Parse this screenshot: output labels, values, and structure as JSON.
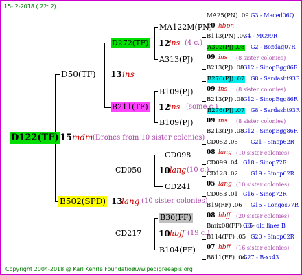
{
  "header": {
    "date": "15-  2-2018 ( 22:  2)"
  },
  "footer": {
    "copyright": "Copyright 2004-2018 @ Karl Kehrle Foundation.",
    "site": "www.pedigreeapis.org"
  },
  "colors": {
    "frame": "#cc00cc",
    "green_box": "#00dd00",
    "yellow_box": "#ffff00",
    "magenta_box": "#ff44ff",
    "cyan_box": "#00eeee",
    "gray_box": "#c0c0c0",
    "lines": "#000000",
    "footer_text": "#007700",
    "id_text": "#0000cc",
    "note_text": "#aa44aa",
    "race_text": "#cc0000"
  },
  "root": {
    "id": "D122(TF)",
    "gen": "15",
    "race": "mdm",
    "note": "(Drones from 10 sister colonies)"
  },
  "father": {
    "id": "D50(TF)",
    "gen": "13",
    "race": "ins"
  },
  "mother": {
    "id": "B502(SPD)",
    "gen": "13",
    "race": "lang",
    "note": "(10 sister colonies)"
  },
  "ff": {
    "id": "D272(TF)",
    "gen": "12",
    "race": "ins",
    "note": "(4 c.)"
  },
  "fm": {
    "id": "B211(TF)",
    "gen": "12",
    "race": "ins",
    "note": "(some c.)"
  },
  "mf": {
    "id": "CD050",
    "gen": "10",
    "race": "lang",
    "note": "(10 c.)"
  },
  "mm": {
    "id": "CD217",
    "gen": "10",
    "race": "hbff",
    "note": "(19 c.)"
  },
  "g4": [
    {
      "id": "MA122M(PN)"
    },
    {
      "id": "A313(PJ)"
    },
    {
      "id": "B109(PJ)"
    },
    {
      "id": "B109(PJ)"
    },
    {
      "id": "CD098"
    },
    {
      "id": "CD241"
    },
    {
      "id": "B30(FF)"
    },
    {
      "id": "B104(FF)"
    }
  ],
  "g5": [
    {
      "a": "MA25(PN) .09",
      "a_code": "G3 - Maced06Q",
      "mid": "10",
      "mid_race": "hbpn",
      "mid_note": "",
      "b": "B113(PN) .07",
      "b_code": "G4 - MG99R"
    },
    {
      "a": "A302(PJ) .08",
      "a_code": "G2 - Bozdag07R",
      "mid": "09",
      "mid_race": "ins",
      "mid_note": "(8 sister colonies)",
      "b": "B213(PJ) .08",
      "b_code": "G12 - SinopEgg86R"
    },
    {
      "a": "B276(PJ) .07",
      "a_code": "G8 - Sardasht93R",
      "mid": "09",
      "mid_race": "ins",
      "mid_note": "(8 sister colonies)",
      "b": "B213(PJ) .08",
      "b_code": "G12 - SinopEgg86R"
    },
    {
      "a": "B276(PJ) .07",
      "a_code": "G8 - Sardasht93R",
      "mid": "09",
      "mid_race": "ins",
      "mid_note": "(8 sister colonies)",
      "b": "B213(PJ) .08",
      "b_code": "G12 - SinopEgg86R"
    },
    {
      "a": "CD052 .05",
      "a_code": "G21 - Sinop62R",
      "mid": "08",
      "mid_race": "lang",
      "mid_note": "(10 sister colonies)",
      "b": "CD099 .04",
      "b_code": "G18 - Sinop72R"
    },
    {
      "a": "CD128 .02",
      "a_code": "G19 - Sinop62R",
      "mid": "05",
      "mid_race": "lang",
      "mid_note": "(10 sister colonies)",
      "b": "CD053 .01",
      "b_code": "G16 - Sinop72R"
    },
    {
      "a": "B19(FF) .06",
      "a_code": "G15 - Longos77R",
      "mid": "08",
      "mid_race": "hbff",
      "mid_note": "(20 sister colonies)",
      "b": "Bmix08(FF) .05",
      "b_code": "G0 - old lines B"
    },
    {
      "a": "B114(FF) .05",
      "a_code": "G20 - Sinop62R",
      "mid": "07",
      "mid_race": "hbff",
      "mid_note": "(16 sister colonies)",
      "b": "B811(FF) .04",
      "b_code": "G27 - B-xx43"
    }
  ]
}
